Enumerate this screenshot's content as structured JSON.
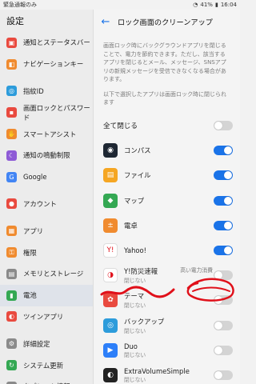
{
  "status_bar": {
    "left": "緊急通報のみ",
    "time": "16:04",
    "battery": "41%"
  },
  "settings_menu": {
    "title": "設定",
    "groups": [
      [
        {
          "label": "通知とステータスバー",
          "icon": "notification-icon",
          "color": "#e94a3f"
        },
        {
          "label": "ナビゲーションキー",
          "icon": "navigation-key-icon",
          "color": "#f08b2f"
        }
      ],
      [
        {
          "label": "指紋ID",
          "icon": "fingerprint-icon",
          "color": "#2d9cdb"
        },
        {
          "label": "画面ロックとパスワード",
          "icon": "lock-icon",
          "color": "#e94a3f"
        },
        {
          "label": "スマートアシスト",
          "icon": "smart-assist-icon",
          "color": "#f08b2f"
        },
        {
          "label": "通知の鳴動制限",
          "icon": "moon-icon",
          "color": "#8e5bd6"
        },
        {
          "label": "Google",
          "icon": "google-icon",
          "color": "#4285f4"
        }
      ],
      [
        {
          "label": "アカウント",
          "icon": "account-icon",
          "color": "#e94a3f"
        }
      ],
      [
        {
          "label": "アプリ",
          "icon": "apps-icon",
          "color": "#f08b2f"
        },
        {
          "label": "権限",
          "icon": "key-icon",
          "color": "#f08b2f"
        },
        {
          "label": "メモリとストレージ",
          "icon": "storage-icon",
          "color": "#8a8a8a"
        },
        {
          "label": "電池",
          "icon": "battery-icon",
          "color": "#34a853",
          "active": true
        },
        {
          "label": "ツインアプリ",
          "icon": "twin-app-icon",
          "color": "#e94a3f"
        }
      ],
      [
        {
          "label": "詳細設定",
          "icon": "gear-icon",
          "color": "#8a8a8a"
        },
        {
          "label": "システム更新",
          "icon": "system-update-icon",
          "color": "#34a853"
        },
        {
          "label": "タブレット情報",
          "icon": "tablet-icon",
          "color": "#8a8a8a"
        }
      ]
    ]
  },
  "detail": {
    "title": "ロック画面のクリーンアップ",
    "description": "画面ロック時にバックグラウンドアプリを閉じることで、電力を節約できます。ただし、該当するアプリを閉じるとメール、メッセージ、SNSアプリの新規メッセージを受信できなくなる場合があります。",
    "note": "以下で選択したアプリは画面ロック時に閉じられます",
    "close_all": {
      "label": "全て閉じる",
      "on": false
    },
    "apps": [
      {
        "name": "コンパス",
        "sub": "",
        "on": true,
        "icon": "compass-icon",
        "color": "#1e2733",
        "glyph": "◉"
      },
      {
        "name": "ファイル",
        "sub": "",
        "on": true,
        "icon": "files-icon",
        "color": "#f5a623",
        "glyph": "▤"
      },
      {
        "name": "マップ",
        "sub": "",
        "on": true,
        "icon": "maps-icon",
        "color": "#34a853",
        "glyph": "◆"
      },
      {
        "name": "電卓",
        "sub": "",
        "on": true,
        "icon": "calculator-icon",
        "color": "#f08b2f",
        "glyph": "±"
      },
      {
        "name": "Yahoo!",
        "sub": "",
        "on": true,
        "icon": "yahoo-icon",
        "color": "#ffffff",
        "glyph": "Y!"
      },
      {
        "name": "Y!防災速報",
        "sub": "閉じない",
        "hint": "高い電力消費",
        "on": false,
        "icon": "disaster-alert-icon",
        "color": "#ffffff",
        "glyph": "◑"
      },
      {
        "name": "テーマ",
        "sub": "閉じない",
        "on": false,
        "icon": "themes-icon",
        "color": "#e94a3f",
        "glyph": "✿"
      },
      {
        "name": "バックアップ",
        "sub": "閉じない",
        "on": false,
        "icon": "backup-icon",
        "color": "#2d9cdb",
        "glyph": "◎"
      },
      {
        "name": "Duo",
        "sub": "閉じない",
        "on": false,
        "icon": "duo-icon",
        "color": "#2d7ff9",
        "glyph": "▶"
      },
      {
        "name": "ExtraVolumeSimple",
        "sub": "閉じない",
        "on": false,
        "icon": "extra-volume-icon",
        "color": "#222222",
        "glyph": "◐"
      }
    ]
  }
}
